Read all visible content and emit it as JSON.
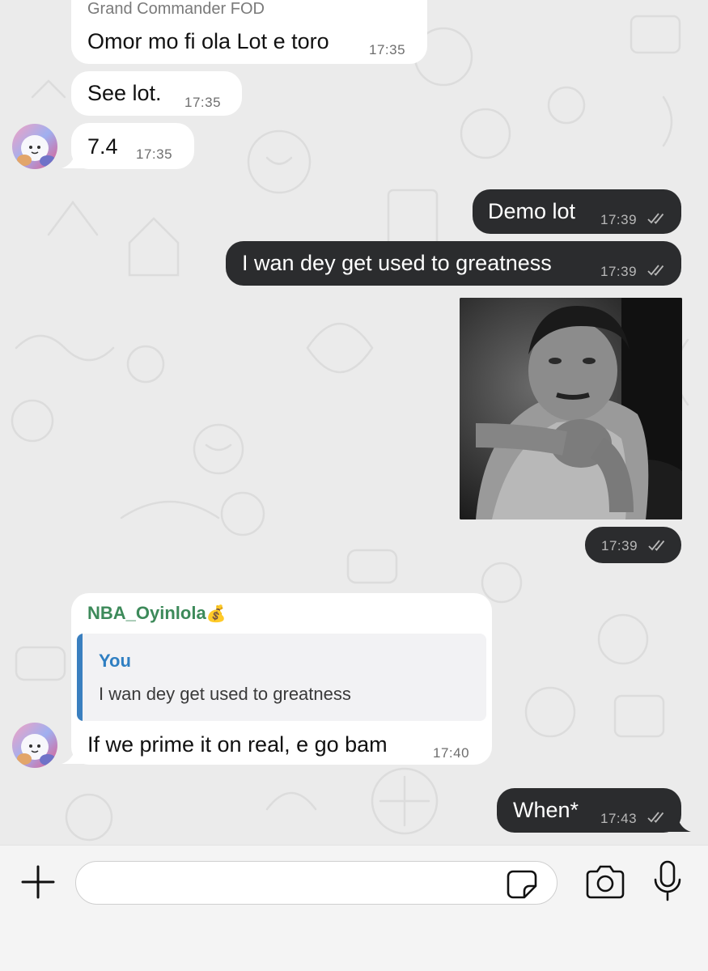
{
  "messages": [
    {
      "type": "incoming",
      "sender": "Grand Commander FOD",
      "text": "Omor mo fi ola Lot e toro",
      "time": "17:35"
    },
    {
      "type": "incoming",
      "text": "See lot.",
      "time": "17:35"
    },
    {
      "type": "incoming",
      "text": "7.4",
      "time": "17:35"
    },
    {
      "type": "outgoing",
      "text": "Demo lot",
      "time": "17:39",
      "status": "read"
    },
    {
      "type": "outgoing",
      "text": "I wan dey get used to greatness",
      "time": "17:39",
      "status": "read"
    },
    {
      "type": "outgoing-image",
      "time": "17:39",
      "status": "read"
    },
    {
      "type": "incoming-reply",
      "sender": "NBA_Oyinlola",
      "sender_emoji": "💰",
      "sender_color": "#3d8a5a",
      "quote": {
        "author": "You",
        "text": "I wan dey get used to greatness",
        "author_color": "#2f7fc2"
      },
      "text": "If we prime it on real, e go bam",
      "time": "17:40"
    },
    {
      "type": "outgoing",
      "text": "When*",
      "time": "17:43",
      "status": "read"
    }
  ],
  "composer": {
    "add_icon": "plus-icon",
    "sticker_icon": "sticker-icon",
    "camera_icon": "camera-icon",
    "mic_icon": "microphone-icon",
    "input_value": ""
  },
  "colors": {
    "outgoing_bubble": "#2b2c2e",
    "incoming_bubble": "#ffffff",
    "background": "#ebebeb"
  }
}
